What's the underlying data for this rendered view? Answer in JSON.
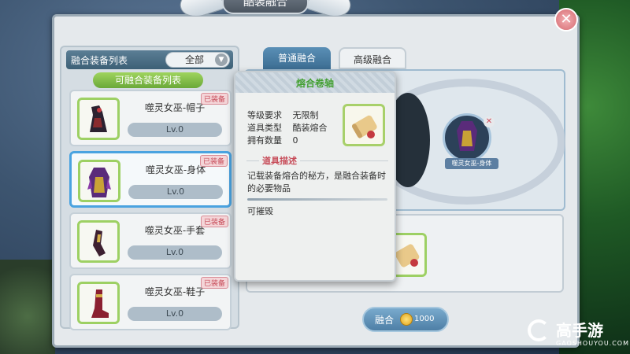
{
  "window": {
    "title": "酷装融合",
    "close": "✕"
  },
  "list_panel": {
    "header_label": "融合装备列表",
    "filter_value": "全部",
    "sub_header": "可融合装备列表",
    "items": [
      {
        "name": "噬灵女巫-帽子",
        "level": "Lv.0",
        "badge": "已装备",
        "icon": "hat-icon"
      },
      {
        "name": "噬灵女巫-身体",
        "level": "Lv.0",
        "badge": "已装备",
        "icon": "robe-icon"
      },
      {
        "name": "噬灵女巫-手套",
        "level": "Lv.0",
        "badge": "已装备",
        "icon": "glove-icon"
      },
      {
        "name": "噬灵女巫-鞋子",
        "level": "Lv.0",
        "badge": "已装备",
        "icon": "boot-icon"
      }
    ]
  },
  "tabs": {
    "normal": "普通融合",
    "advanced": "高级融合"
  },
  "fusion": {
    "target_label": "噬灵女巫-身体",
    "fuse_button": "融合",
    "cost": "1000"
  },
  "tooltip": {
    "title": "熔合卷轴",
    "level_req_key": "等级要求",
    "level_req_val": "无限制",
    "type_key": "道具类型",
    "type_val": "酷装熔合",
    "owned_key": "拥有数量",
    "owned_val": "0",
    "section": "道具描述",
    "description": "记载装备熔合的秘方，是融合装备时的必要物品",
    "extra": "可摧毁"
  },
  "watermark": {
    "brand": "高手游",
    "domain": "GAOSHOUYOU.COM"
  },
  "colors": {
    "accent": "#4aa3e0",
    "green_title": "#43a032",
    "badge": "#c74d5a"
  }
}
